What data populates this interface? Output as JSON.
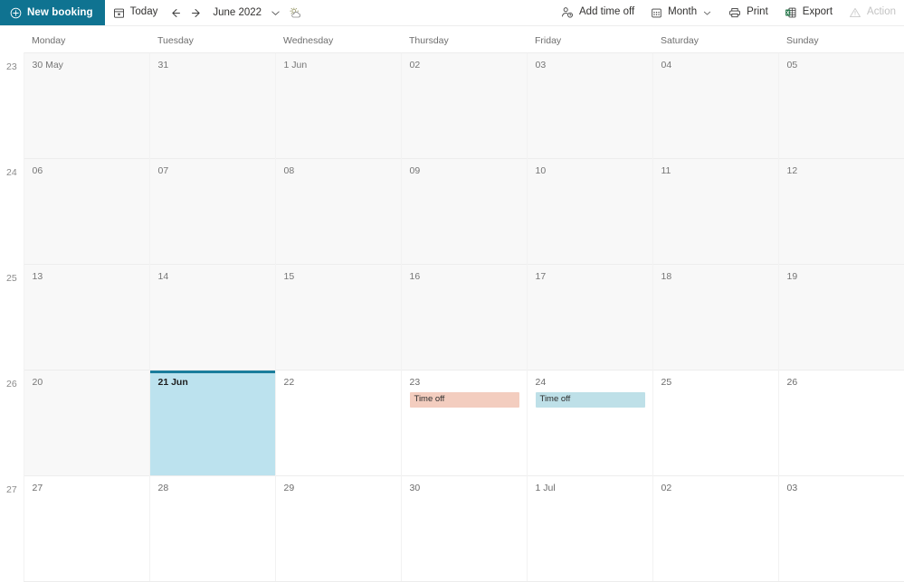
{
  "toolbar": {
    "new_booking": {
      "label": "New booking",
      "icon": "plus-circle-icon"
    },
    "today": {
      "label": "Today",
      "icon": "calendar-today-icon"
    },
    "prev": {
      "icon": "arrow-left-icon"
    },
    "next": {
      "icon": "arrow-right-icon"
    },
    "period_label": "June 2022",
    "period_chevron": "chevron-down-icon",
    "weather": {
      "icon": "weather-partly-cloudy-icon"
    },
    "add_time_off": {
      "label": "Add time off",
      "icon": "person-clock-icon"
    },
    "view": {
      "label": "Month",
      "icon": "view-month-icon",
      "chevron": "chevron-down-icon"
    },
    "print": {
      "label": "Print",
      "icon": "printer-icon"
    },
    "export": {
      "label": "Export",
      "icon": "excel-export-icon"
    },
    "action": {
      "label": "Action",
      "icon": "warning-triangle-icon",
      "disabled": true
    },
    "accent_color": "#0f7391"
  },
  "calendar": {
    "weekday_headers": [
      "Monday",
      "Tuesday",
      "Wednesday",
      "Thursday",
      "Friday",
      "Saturday",
      "Sunday"
    ],
    "selected_color": "#bce2ee",
    "selected_border_color": "#1a7d9c",
    "past_color": "#f8f8f8",
    "weeks": [
      {
        "week_number": "23",
        "days": [
          {
            "label": "30 May",
            "past": true,
            "selected": false,
            "events": []
          },
          {
            "label": "31",
            "past": true,
            "selected": false,
            "events": []
          },
          {
            "label": "1 Jun",
            "past": true,
            "selected": false,
            "events": []
          },
          {
            "label": "02",
            "past": true,
            "selected": false,
            "events": []
          },
          {
            "label": "03",
            "past": true,
            "selected": false,
            "events": []
          },
          {
            "label": "04",
            "past": true,
            "selected": false,
            "events": []
          },
          {
            "label": "05",
            "past": true,
            "selected": false,
            "events": []
          }
        ]
      },
      {
        "week_number": "24",
        "days": [
          {
            "label": "06",
            "past": true,
            "selected": false,
            "events": []
          },
          {
            "label": "07",
            "past": true,
            "selected": false,
            "events": []
          },
          {
            "label": "08",
            "past": true,
            "selected": false,
            "events": []
          },
          {
            "label": "09",
            "past": true,
            "selected": false,
            "events": []
          },
          {
            "label": "10",
            "past": true,
            "selected": false,
            "events": []
          },
          {
            "label": "11",
            "past": true,
            "selected": false,
            "events": []
          },
          {
            "label": "12",
            "past": true,
            "selected": false,
            "events": []
          }
        ]
      },
      {
        "week_number": "25",
        "days": [
          {
            "label": "13",
            "past": true,
            "selected": false,
            "events": []
          },
          {
            "label": "14",
            "past": true,
            "selected": false,
            "events": []
          },
          {
            "label": "15",
            "past": true,
            "selected": false,
            "events": []
          },
          {
            "label": "16",
            "past": true,
            "selected": false,
            "events": []
          },
          {
            "label": "17",
            "past": true,
            "selected": false,
            "events": []
          },
          {
            "label": "18",
            "past": true,
            "selected": false,
            "events": []
          },
          {
            "label": "19",
            "past": true,
            "selected": false,
            "events": []
          }
        ]
      },
      {
        "week_number": "26",
        "days": [
          {
            "label": "20",
            "past": true,
            "selected": false,
            "events": []
          },
          {
            "label": "21 Jun",
            "past": false,
            "selected": true,
            "events": []
          },
          {
            "label": "22",
            "past": false,
            "selected": false,
            "events": []
          },
          {
            "label": "23",
            "past": false,
            "selected": false,
            "events": [
              {
                "title": "Time off",
                "color": "peach"
              }
            ]
          },
          {
            "label": "24",
            "past": false,
            "selected": false,
            "events": [
              {
                "title": "Time off",
                "color": "blue"
              }
            ]
          },
          {
            "label": "25",
            "past": false,
            "selected": false,
            "events": []
          },
          {
            "label": "26",
            "past": false,
            "selected": false,
            "events": []
          }
        ]
      },
      {
        "week_number": "27",
        "days": [
          {
            "label": "27",
            "past": false,
            "selected": false,
            "events": []
          },
          {
            "label": "28",
            "past": false,
            "selected": false,
            "events": []
          },
          {
            "label": "29",
            "past": false,
            "selected": false,
            "events": []
          },
          {
            "label": "30",
            "past": false,
            "selected": false,
            "events": []
          },
          {
            "label": "1 Jul",
            "past": false,
            "selected": false,
            "events": []
          },
          {
            "label": "02",
            "past": false,
            "selected": false,
            "events": []
          },
          {
            "label": "03",
            "past": false,
            "selected": false,
            "events": []
          }
        ]
      }
    ]
  }
}
